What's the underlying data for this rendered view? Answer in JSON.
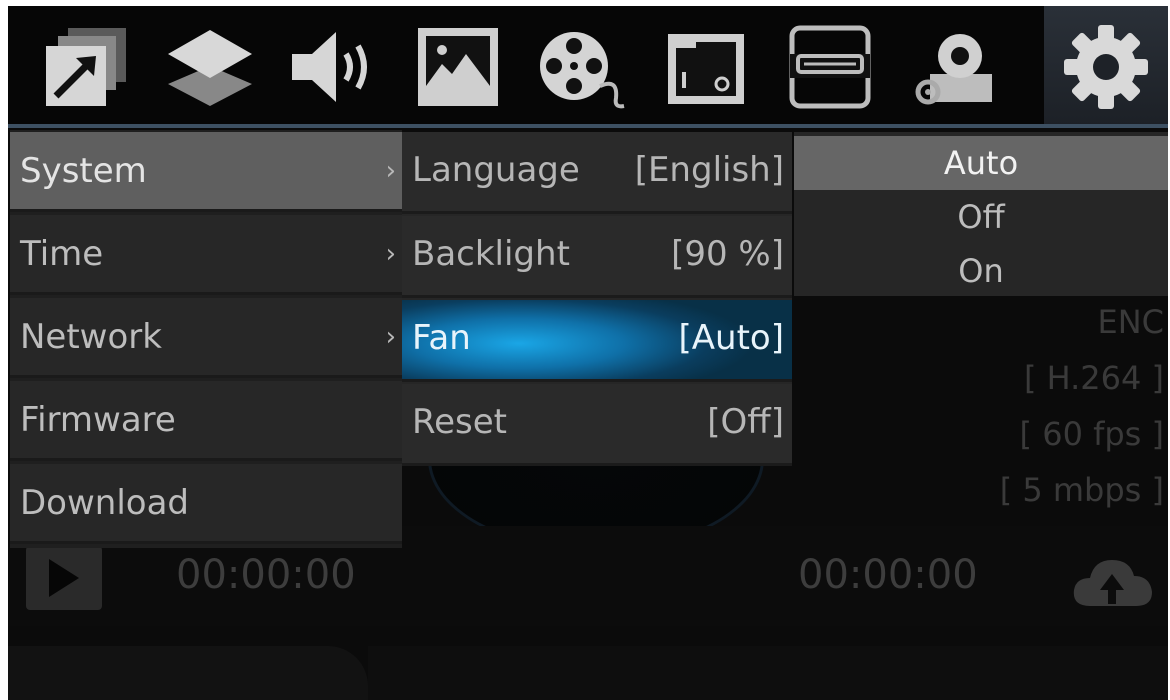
{
  "toolbar": {
    "icons": [
      {
        "name": "output-icon"
      },
      {
        "name": "layers-icon"
      },
      {
        "name": "audio-icon"
      },
      {
        "name": "image-icon"
      },
      {
        "name": "film-reel-icon"
      },
      {
        "name": "sd-card-icon"
      },
      {
        "name": "hdmi-icon"
      },
      {
        "name": "camera-settings-icon"
      },
      {
        "name": "gear-icon"
      }
    ],
    "active_index": 8
  },
  "menu_level1": {
    "items": [
      {
        "label": "System",
        "arrow": "›",
        "selected": true
      },
      {
        "label": "Time",
        "arrow": "›",
        "selected": false
      },
      {
        "label": "Network",
        "arrow": "›",
        "selected": false
      },
      {
        "label": "Firmware",
        "arrow": "",
        "selected": false
      },
      {
        "label": "Download",
        "arrow": "",
        "selected": false
      }
    ]
  },
  "menu_level2": {
    "items": [
      {
        "label": "Language",
        "value": "[English]",
        "selected": false
      },
      {
        "label": "Backlight",
        "value": "[90 %]",
        "selected": false
      },
      {
        "label": "Fan",
        "value": "[Auto]",
        "selected": true
      },
      {
        "label": "Reset",
        "value": "[Off]",
        "selected": false
      }
    ]
  },
  "menu_level3": {
    "options": [
      {
        "label": "Auto",
        "selected": true
      },
      {
        "label": "Off",
        "selected": false
      },
      {
        "label": "On",
        "selected": false
      }
    ]
  },
  "encoding": {
    "label": "ENC",
    "codec": "[ H.264 ]",
    "fps": "[ 60 fps ]",
    "bitrate": "[ 5 mbps ]"
  },
  "playback": {
    "timecode_left": "00:00:00",
    "timecode_right": "00:00:00"
  },
  "colors": {
    "highlight": "#1aa6e6",
    "menu_bg": "#262626",
    "selected_gray": "#5f5f5f"
  }
}
